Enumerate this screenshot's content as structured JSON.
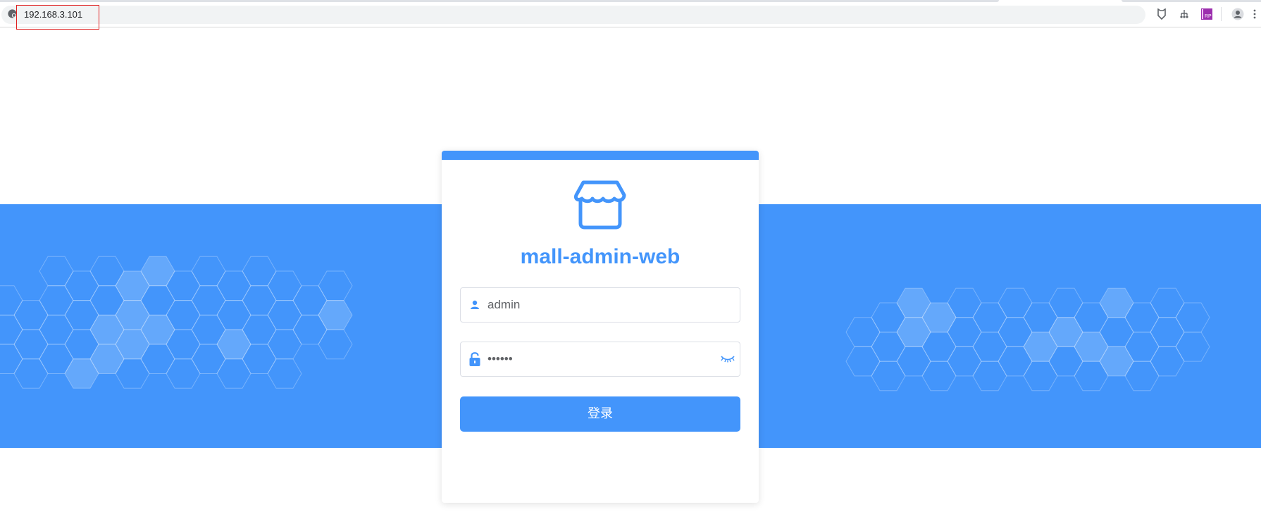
{
  "browser": {
    "address_bar": {
      "url": "192.168.3.101"
    },
    "toolbar_icons": [
      "extension-puzzle-icon",
      "extension-tree-icon",
      "extension-rp-icon",
      "profile-avatar-icon",
      "more-menu-icon"
    ],
    "rp_badge_text": "RP"
  },
  "login": {
    "title": "mall-admin-web",
    "username": {
      "value": "admin",
      "icon": "user-icon"
    },
    "password": {
      "value": "••••••",
      "icon": "lock-icon",
      "toggle_icon": "eye-closed-icon"
    },
    "submit_label": "登录"
  },
  "colors": {
    "primary": "#4395fb",
    "card_background": "#ffffff",
    "input_border": "#dcdfe6",
    "url_highlight_border": "#e02020"
  }
}
